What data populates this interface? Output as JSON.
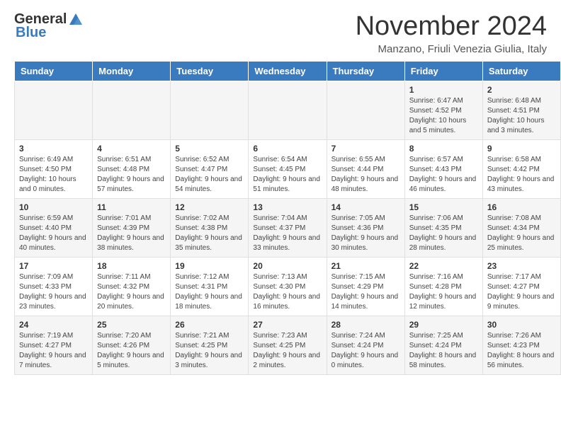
{
  "header": {
    "logo_general": "General",
    "logo_blue": "Blue",
    "title": "November 2024",
    "location": "Manzano, Friuli Venezia Giulia, Italy"
  },
  "days_of_week": [
    "Sunday",
    "Monday",
    "Tuesday",
    "Wednesday",
    "Thursday",
    "Friday",
    "Saturday"
  ],
  "weeks": [
    {
      "days": [
        {
          "num": "",
          "info": ""
        },
        {
          "num": "",
          "info": ""
        },
        {
          "num": "",
          "info": ""
        },
        {
          "num": "",
          "info": ""
        },
        {
          "num": "",
          "info": ""
        },
        {
          "num": "1",
          "info": "Sunrise: 6:47 AM\nSunset: 4:52 PM\nDaylight: 10 hours and 5 minutes."
        },
        {
          "num": "2",
          "info": "Sunrise: 6:48 AM\nSunset: 4:51 PM\nDaylight: 10 hours and 3 minutes."
        }
      ]
    },
    {
      "days": [
        {
          "num": "3",
          "info": "Sunrise: 6:49 AM\nSunset: 4:50 PM\nDaylight: 10 hours and 0 minutes."
        },
        {
          "num": "4",
          "info": "Sunrise: 6:51 AM\nSunset: 4:48 PM\nDaylight: 9 hours and 57 minutes."
        },
        {
          "num": "5",
          "info": "Sunrise: 6:52 AM\nSunset: 4:47 PM\nDaylight: 9 hours and 54 minutes."
        },
        {
          "num": "6",
          "info": "Sunrise: 6:54 AM\nSunset: 4:45 PM\nDaylight: 9 hours and 51 minutes."
        },
        {
          "num": "7",
          "info": "Sunrise: 6:55 AM\nSunset: 4:44 PM\nDaylight: 9 hours and 48 minutes."
        },
        {
          "num": "8",
          "info": "Sunrise: 6:57 AM\nSunset: 4:43 PM\nDaylight: 9 hours and 46 minutes."
        },
        {
          "num": "9",
          "info": "Sunrise: 6:58 AM\nSunset: 4:42 PM\nDaylight: 9 hours and 43 minutes."
        }
      ]
    },
    {
      "days": [
        {
          "num": "10",
          "info": "Sunrise: 6:59 AM\nSunset: 4:40 PM\nDaylight: 9 hours and 40 minutes."
        },
        {
          "num": "11",
          "info": "Sunrise: 7:01 AM\nSunset: 4:39 PM\nDaylight: 9 hours and 38 minutes."
        },
        {
          "num": "12",
          "info": "Sunrise: 7:02 AM\nSunset: 4:38 PM\nDaylight: 9 hours and 35 minutes."
        },
        {
          "num": "13",
          "info": "Sunrise: 7:04 AM\nSunset: 4:37 PM\nDaylight: 9 hours and 33 minutes."
        },
        {
          "num": "14",
          "info": "Sunrise: 7:05 AM\nSunset: 4:36 PM\nDaylight: 9 hours and 30 minutes."
        },
        {
          "num": "15",
          "info": "Sunrise: 7:06 AM\nSunset: 4:35 PM\nDaylight: 9 hours and 28 minutes."
        },
        {
          "num": "16",
          "info": "Sunrise: 7:08 AM\nSunset: 4:34 PM\nDaylight: 9 hours and 25 minutes."
        }
      ]
    },
    {
      "days": [
        {
          "num": "17",
          "info": "Sunrise: 7:09 AM\nSunset: 4:33 PM\nDaylight: 9 hours and 23 minutes."
        },
        {
          "num": "18",
          "info": "Sunrise: 7:11 AM\nSunset: 4:32 PM\nDaylight: 9 hours and 20 minutes."
        },
        {
          "num": "19",
          "info": "Sunrise: 7:12 AM\nSunset: 4:31 PM\nDaylight: 9 hours and 18 minutes."
        },
        {
          "num": "20",
          "info": "Sunrise: 7:13 AM\nSunset: 4:30 PM\nDaylight: 9 hours and 16 minutes."
        },
        {
          "num": "21",
          "info": "Sunrise: 7:15 AM\nSunset: 4:29 PM\nDaylight: 9 hours and 14 minutes."
        },
        {
          "num": "22",
          "info": "Sunrise: 7:16 AM\nSunset: 4:28 PM\nDaylight: 9 hours and 12 minutes."
        },
        {
          "num": "23",
          "info": "Sunrise: 7:17 AM\nSunset: 4:27 PM\nDaylight: 9 hours and 9 minutes."
        }
      ]
    },
    {
      "days": [
        {
          "num": "24",
          "info": "Sunrise: 7:19 AM\nSunset: 4:27 PM\nDaylight: 9 hours and 7 minutes."
        },
        {
          "num": "25",
          "info": "Sunrise: 7:20 AM\nSunset: 4:26 PM\nDaylight: 9 hours and 5 minutes."
        },
        {
          "num": "26",
          "info": "Sunrise: 7:21 AM\nSunset: 4:25 PM\nDaylight: 9 hours and 3 minutes."
        },
        {
          "num": "27",
          "info": "Sunrise: 7:23 AM\nSunset: 4:25 PM\nDaylight: 9 hours and 2 minutes."
        },
        {
          "num": "28",
          "info": "Sunrise: 7:24 AM\nSunset: 4:24 PM\nDaylight: 9 hours and 0 minutes."
        },
        {
          "num": "29",
          "info": "Sunrise: 7:25 AM\nSunset: 4:24 PM\nDaylight: 8 hours and 58 minutes."
        },
        {
          "num": "30",
          "info": "Sunrise: 7:26 AM\nSunset: 4:23 PM\nDaylight: 8 hours and 56 minutes."
        }
      ]
    }
  ]
}
